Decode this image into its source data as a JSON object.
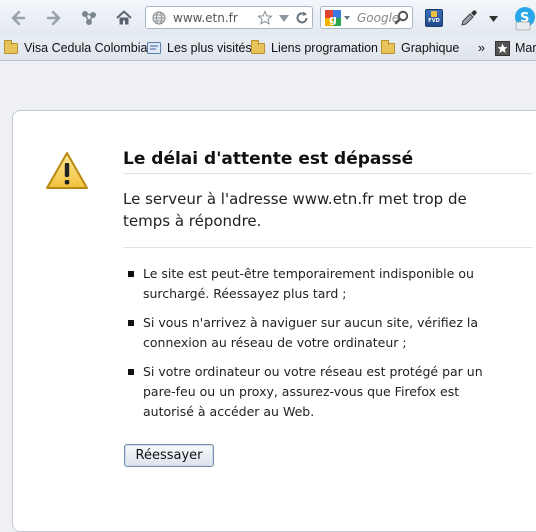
{
  "toolbar": {
    "url": "www.etn.fr",
    "search_placeholder": "Google",
    "fvd_label": "FVD"
  },
  "bookmarks": {
    "items": [
      "Visa Cedula Colombia",
      "Les plus visités",
      "Liens programation",
      "Graphique"
    ],
    "overflow": "»",
    "last_label": "Mar"
  },
  "error": {
    "title": "Le délai d'attente est dépassé",
    "description": "Le serveur à l'adresse www.etn.fr met trop de temps à répondre.",
    "reasons": [
      "Le site est peut-être temporairement indisponible ou surchargé. Réessayez plus tard ;",
      "Si vous n'arrivez à naviguer sur aucun site, vérifiez la connexion au réseau de votre ordinateur ;",
      "Si votre ordinateur ou votre réseau est protégé par un pare-feu ou un proxy, assurez-vous que Firefox est autorisé à accéder au Web."
    ],
    "retry_label": "Réessayer"
  }
}
